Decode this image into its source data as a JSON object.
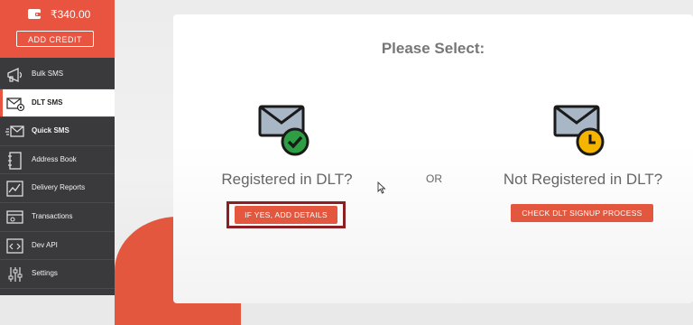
{
  "wallet": {
    "balance": "₹340.00",
    "add_credit_label": "ADD CREDIT"
  },
  "sidebar": {
    "items": [
      {
        "label": "Bulk SMS",
        "icon": "megaphone-icon"
      },
      {
        "label": "DLT SMS",
        "icon": "mail-settings-icon",
        "active": true
      },
      {
        "label": "Quick SMS",
        "icon": "quick-mail-icon"
      },
      {
        "label": "Address Book",
        "icon": "address-book-icon"
      },
      {
        "label": "Delivery Reports",
        "icon": "report-chart-icon"
      },
      {
        "label": "Transactions",
        "icon": "transactions-icon"
      },
      {
        "label": "Dev API",
        "icon": "code-icon"
      },
      {
        "label": "Settings",
        "icon": "settings-sliders-icon"
      }
    ]
  },
  "main": {
    "title": "Please Select:",
    "or_label": "OR",
    "registered": {
      "title": "Registered in DLT?",
      "button_label": "IF YES, ADD DETAILS",
      "icon": "mail-check-icon"
    },
    "not_registered": {
      "title": "Not Registered in DLT?",
      "button_label": "CHECK DLT SIGNUP PROCESS",
      "icon": "mail-clock-icon"
    }
  },
  "colors": {
    "accent": "#e3573f",
    "sidebar": "#3a3a3c",
    "highlight": "#8c1f24",
    "check": "#2e9e45",
    "clock": "#f5b400"
  }
}
